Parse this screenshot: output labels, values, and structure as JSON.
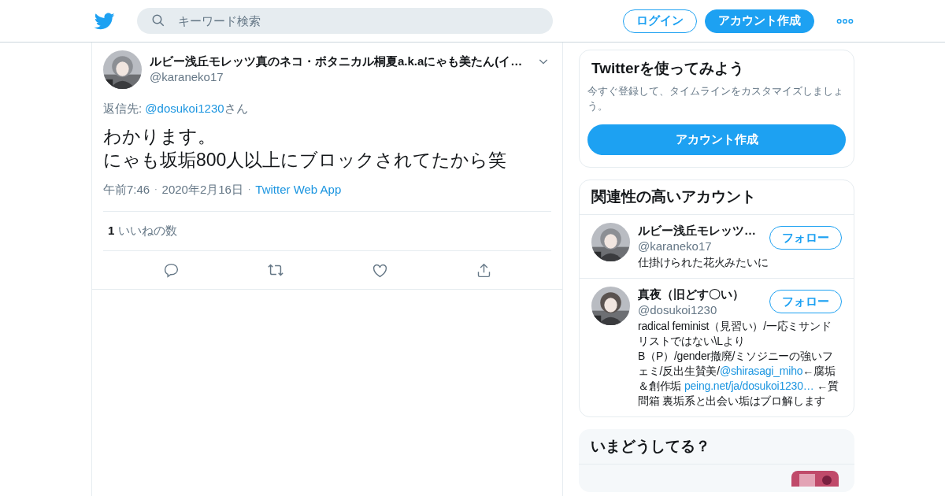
{
  "header": {
    "search": {
      "placeholder": "キーワード検索"
    },
    "buttons": [
      {
        "kind": "outline",
        "label": "ログイン"
      },
      {
        "kind": "filled",
        "label": "アカウント作成"
      }
    ]
  },
  "tweet": {
    "name": "ルビー浅丘モレッツ真のネコ・ボタニカル桐夏a.k.aにゃも美たん(イ…",
    "handle": "@karaneko17",
    "reply_prefix": "返信先: ",
    "reply_to": "@dosukoi1230",
    "reply_suffix": "さん",
    "text": [
      "わかります。",
      "にゃも坂垢800人以上にブロックされてたから笑"
    ],
    "time": "午前7:46",
    "separator": "·",
    "date": "2020年2月16日",
    "source": "Twitter Web App",
    "like_count": "1",
    "like_label": "いいねの数"
  },
  "signup_card": {
    "title": "Twitterを使ってみよう",
    "text": "今すぐ登録して、タイムラインをカスタマイズしましょう。",
    "button": "アカウント作成"
  },
  "related": {
    "title": "関連性の高いアカウント",
    "accounts": [
      {
        "name": "ルビー浅丘モレッツ…",
        "handle": "@karaneko17",
        "button": "フォロー",
        "bio": [
          {
            "kind": "text",
            "text": "仕掛けられた花火みたいに"
          }
        ]
      },
      {
        "name": "真夜（旧どす〇い）",
        "handle": "@dosukoi1230",
        "button": "フォロー",
        "bio": [
          {
            "kind": "text",
            "text": "radical feminist（見習い）/一応ミサンドリストではない\\Lより\nB（P）/gender撤廃/ミソジニーの強いフェミ/反出生賛美/"
          },
          {
            "kind": "link",
            "text": "@shirasagi_miho"
          },
          {
            "kind": "text",
            "text": "←腐垢＆創作垢 "
          },
          {
            "kind": "link",
            "text": "peing.net/ja/dosukoi1230…"
          },
          {
            "kind": "text",
            "text": " ←質問箱 裏垢系と出会い垢はブロ解します"
          }
        ]
      }
    ]
  },
  "trends": {
    "title": "いまどうしてる？"
  }
}
